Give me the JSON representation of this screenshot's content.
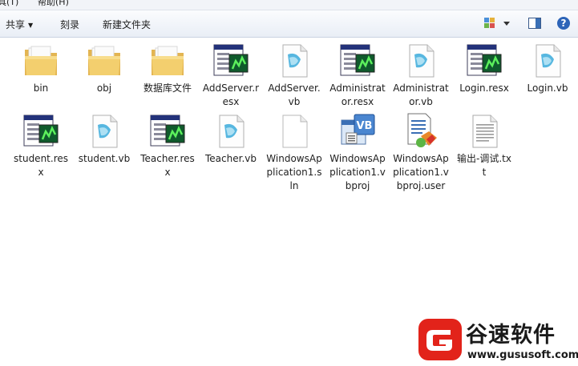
{
  "menubar": {
    "tools": "具(T)",
    "help": "帮助(H)"
  },
  "toolbar": {
    "share": "共享",
    "burn": "刻录",
    "new_folder": "新建文件夹",
    "view_icon": "view-options-icon",
    "preview_icon": "preview-pane-icon",
    "help_icon": "help-icon"
  },
  "files": [
    {
      "name": "bin",
      "icon": "folder-icon"
    },
    {
      "name": "obj",
      "icon": "folder-icon"
    },
    {
      "name": "数据库文件",
      "icon": "folder-icon"
    },
    {
      "name": "AddServer.resx",
      "icon": "resx-file-icon"
    },
    {
      "name": "AddServer.vb",
      "icon": "vb-file-icon"
    },
    {
      "name": "Administrator.resx",
      "icon": "resx-file-icon"
    },
    {
      "name": "Administrator.vb",
      "icon": "vb-file-icon"
    },
    {
      "name": "Login.resx",
      "icon": "resx-file-icon"
    },
    {
      "name": "Login.vb",
      "icon": "vb-file-icon"
    },
    {
      "name": "student.resx",
      "icon": "resx-file-icon"
    },
    {
      "name": "student.vb",
      "icon": "vb-file-icon"
    },
    {
      "name": "Teacher.resx",
      "icon": "resx-file-icon"
    },
    {
      "name": "Teacher.vb",
      "icon": "vb-file-icon"
    },
    {
      "name": "WindowsApplication1.sln",
      "icon": "sln-file-icon"
    },
    {
      "name": "WindowsApplication1.vbproj",
      "icon": "vbproj-file-icon"
    },
    {
      "name": "WindowsApplication1.vbproj.user",
      "icon": "vbproj-user-file-icon"
    },
    {
      "name": "输出-调试.txt",
      "icon": "txt-file-icon"
    }
  ],
  "watermark": {
    "title": "谷速软件",
    "url": "www.gususoft.com"
  },
  "colors": {
    "folder": "#f3cf6e",
    "accent_red": "#e2231a",
    "toolbar_border": "#c9d3e1"
  }
}
